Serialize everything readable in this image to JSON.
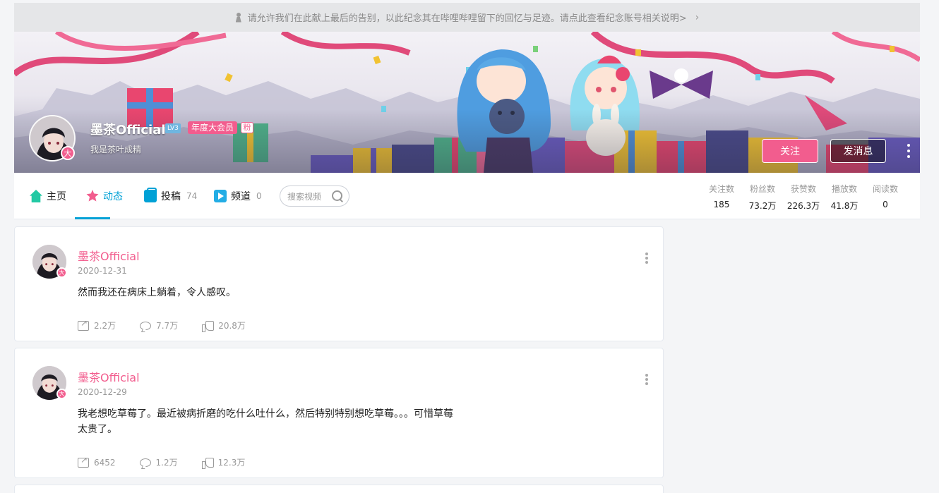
{
  "notice": {
    "text": "请允许我们在此献上最后的告别，以此纪念其在哔哩哔哩留下的回忆与足迹。请点此查看纪念账号相关说明>",
    "icon": "candle-icon",
    "chevron": "›"
  },
  "profile": {
    "name": "墨茶Official",
    "level": "LV3",
    "vip_label": "年度大会员",
    "fan_label": "粉",
    "signature": "我是茶叶成精",
    "avatar_badge": "大",
    "follow_label": "关注",
    "message_label": "发消息"
  },
  "nav": {
    "home": "主页",
    "dynamics": "动态",
    "posts": "投稿",
    "posts_count": "74",
    "channels": "频道",
    "channels_count": "0",
    "search_placeholder": "搜索视频"
  },
  "stats": [
    {
      "label": "关注数",
      "value": "185"
    },
    {
      "label": "粉丝数",
      "value": "73.2万"
    },
    {
      "label": "获赞数",
      "value": "226.3万"
    },
    {
      "label": "播放数",
      "value": "41.8万"
    },
    {
      "label": "阅读数",
      "value": "0"
    }
  ],
  "posts": [
    {
      "author": "墨茶Official",
      "badge": "大",
      "date": "2020-12-31",
      "content": "然而我还在病床上躺着，令人感叹。",
      "shares": "2.2万",
      "comments": "7.7万",
      "likes": "20.8万"
    },
    {
      "author": "墨茶Official",
      "badge": "大",
      "date": "2020-12-29",
      "content": "我老想吃草莓了。最近被病折磨的吃什么吐什么，然后特别特别想吃草莓。。。可惜草莓太贵了。",
      "shares": "6452",
      "comments": "1.2万",
      "likes": "12.3万"
    }
  ],
  "colors": {
    "accent_pink": "#f25d8e",
    "accent_blue": "#00a1d6",
    "background": "#f4f5f7"
  }
}
